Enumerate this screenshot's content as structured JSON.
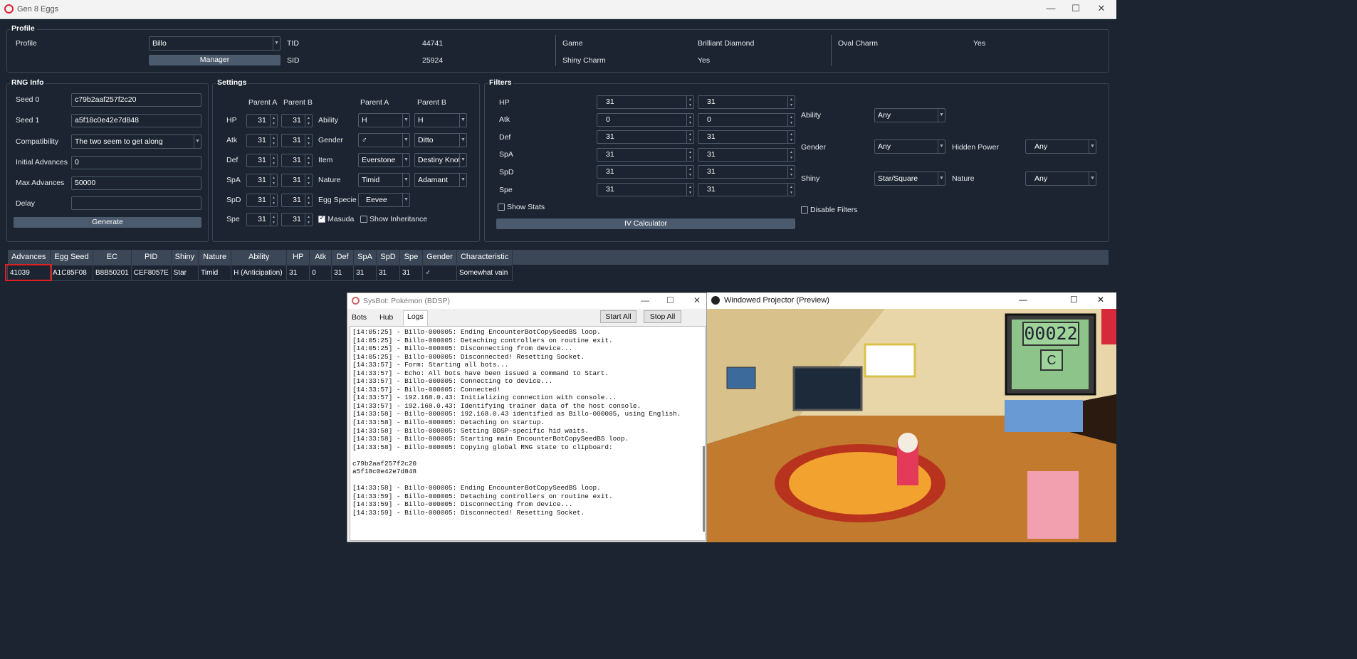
{
  "window": {
    "title": "Gen 8 Eggs",
    "minimize": "—",
    "maximize": "☐",
    "close": "✕"
  },
  "profile": {
    "group": "Profile",
    "label": "Profile",
    "value": "Billo",
    "manager": "Manager",
    "tid_label": "TID",
    "tid": "44741",
    "sid_label": "SID",
    "sid": "25924",
    "game_label": "Game",
    "game": "Brilliant Diamond",
    "shiny_charm_label": "Shiny Charm",
    "shiny_charm": "Yes",
    "oval_charm_label": "Oval Charm",
    "oval_charm": "Yes"
  },
  "rng": {
    "group": "RNG Info",
    "seed0_label": "Seed 0",
    "seed0": "c79b2aaf257f2c20",
    "seed1_label": "Seed 1",
    "seed1": "a5f18c0e42e7d848",
    "compat_label": "Compatibility",
    "compat": "The two seem to get along",
    "initial_label": "Initial Advances",
    "initial": "0",
    "max_label": "Max Advances",
    "max": "50000",
    "delay_label": "Delay",
    "delay": "",
    "generate": "Generate"
  },
  "settings": {
    "group": "Settings",
    "parent_a": "Parent A",
    "parent_b": "Parent B",
    "stats": [
      "HP",
      "Atk",
      "Def",
      "SpA",
      "SpD",
      "Spe"
    ],
    "ivs_a": [
      "31",
      "31",
      "31",
      "31",
      "31",
      "31"
    ],
    "ivs_b": [
      "31",
      "31",
      "31",
      "31",
      "31",
      "31"
    ],
    "ability_label": "Ability",
    "ability_a": "H",
    "ability_b": "H",
    "gender_label": "Gender",
    "gender_a": "♂",
    "gender_b": "Ditto",
    "item_label": "Item",
    "item_a": "Everstone",
    "item_b": "Destiny Knot",
    "nature_label": "Nature",
    "nature_a": "Timid",
    "nature_b": "Adamant",
    "egg_label": "Egg Specie",
    "egg": "Eevee",
    "masuda": "Masuda",
    "inheritance": "Show Inheritance"
  },
  "filters": {
    "group": "Filters",
    "stats": [
      "HP",
      "Atk",
      "Def",
      "SpA",
      "SpD",
      "Spe"
    ],
    "min": [
      "31",
      "0",
      "31",
      "31",
      "31",
      "31"
    ],
    "max": [
      "31",
      "0",
      "31",
      "31",
      "31",
      "31"
    ],
    "show_stats": "Show Stats",
    "iv_calc": "IV Calculator",
    "ability_label": "Ability",
    "ability": "Any",
    "gender_label": "Gender",
    "gender": "Any",
    "hp_label": "Hidden Power",
    "hp": "Any",
    "shiny_label": "Shiny",
    "shiny": "Star/Square",
    "nature_label": "Nature",
    "nature": "Any",
    "disable": "Disable Filters"
  },
  "results": {
    "headers": [
      "Advances",
      "Egg Seed",
      "EC",
      "PID",
      "Shiny",
      "Nature",
      "Ability",
      "HP",
      "Atk",
      "Def",
      "SpA",
      "SpD",
      "Spe",
      "Gender",
      "Characteristic"
    ],
    "row": [
      "41039",
      "A1C85F08",
      "B8B50201",
      "CEF8057E",
      "Star",
      "Timid",
      "H (Anticipation)",
      "31",
      "0",
      "31",
      "31",
      "31",
      "31",
      "♂",
      "Somewhat vain"
    ]
  },
  "sysbot": {
    "title": "SysBot: Pokémon (BDSP)",
    "tabs": [
      "Bots",
      "Hub",
      "Logs"
    ],
    "start": "Start All",
    "stop": "Stop All",
    "log": "[14:05:25] - Billo-000005: Ending EncounterBotCopySeedBS loop.\n[14:05:25] - Billo-000005: Detaching controllers on routine exit.\n[14:05:25] - Billo-000005: Disconnecting from device...\n[14:05:25] - Billo-000005: Disconnected! Resetting Socket.\n[14:33:57] - Form: Starting all bots...\n[14:33:57] - Echo: All bots have been issued a command to Start.\n[14:33:57] - Billo-000005: Connecting to device...\n[14:33:57] - Billo-000005: Connected!\n[14:33:57] - 192.168.0.43: Initializing connection with console...\n[14:33:57] - 192.168.0.43: Identifying trainer data of the host console.\n[14:33:58] - Billo-000005: 192.168.0.43 identified as Billo-000005, using English.\n[14:33:58] - Billo-000005: Detaching on startup.\n[14:33:58] - Billo-000005: Setting BDSP-specific hid waits.\n[14:33:58] - Billo-000005: Starting main EncounterBotCopySeedBS loop.\n[14:33:58] - Billo-000005: Copying global RNG state to clipboard:\n\nc79b2aaf257f2c20\na5f18c0e42e7d848\n\n[14:33:58] - Billo-000005: Ending EncounterBotCopySeedBS loop.\n[14:33:59] - Billo-000005: Detaching controllers on routine exit.\n[14:33:59] - Billo-000005: Disconnecting from device...\n[14:33:59] - Billo-000005: Disconnected! Resetting Socket."
  },
  "projector": {
    "title": "Windowed Projector (Preview)",
    "counter": "00022",
    "c": "C"
  }
}
